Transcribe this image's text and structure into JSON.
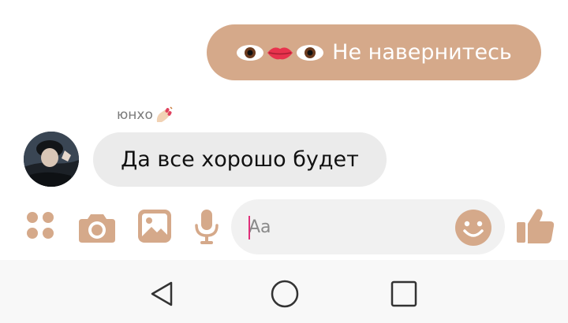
{
  "messages": {
    "outgoing_text": "Не навернитесь",
    "sender_name": "юнхо",
    "incoming_text": "Да все хорошо будет"
  },
  "composer": {
    "placeholder": "Aa"
  },
  "colors": {
    "accent": "#d5a98a",
    "outgoing_bubble": "#d5a98a",
    "incoming_bubble": "#ebebeb",
    "caret": "#e0307a"
  },
  "icons": {
    "toolbar": [
      "apps-icon",
      "camera-icon",
      "image-icon",
      "microphone-icon"
    ],
    "composer": "emoji-smile-icon",
    "send": "thumbs-up-icon",
    "nav": [
      "back-icon",
      "home-icon",
      "recents-icon"
    ]
  }
}
